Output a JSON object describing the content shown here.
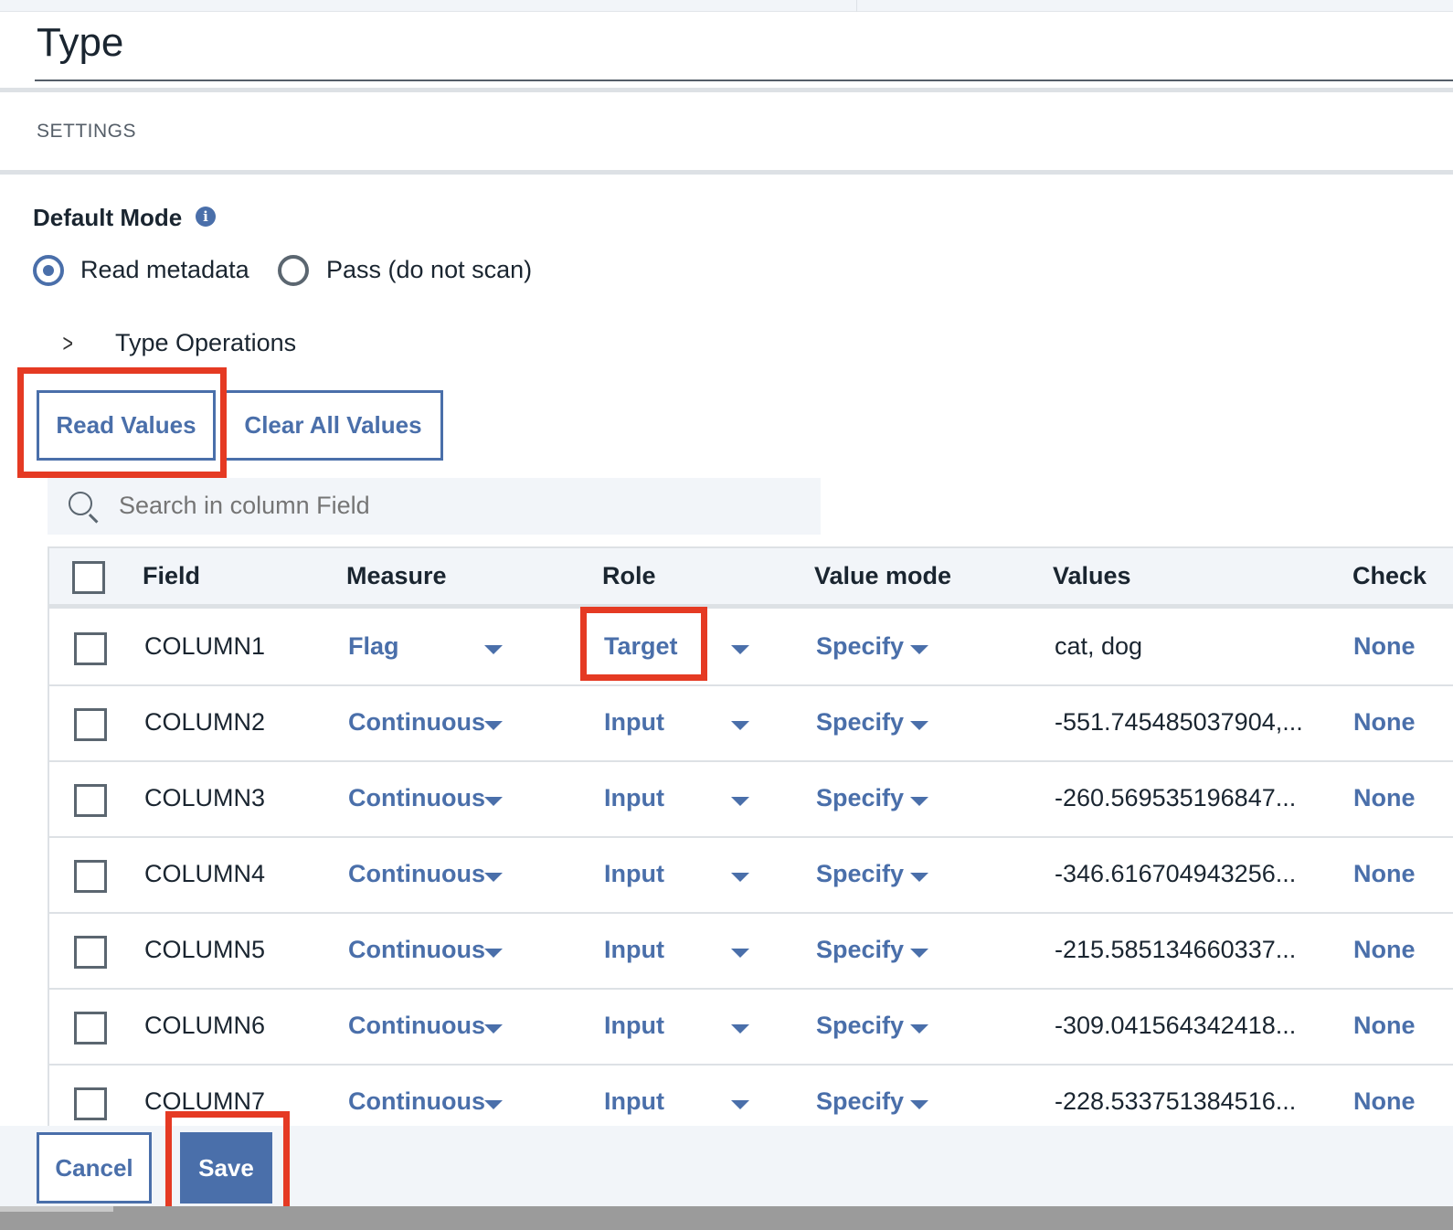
{
  "header": {
    "title": "Type",
    "section": "SETTINGS"
  },
  "default_mode": {
    "label": "Default Mode",
    "info_icon": "i",
    "options": [
      {
        "label": "Read metadata",
        "selected": true
      },
      {
        "label": "Pass (do not scan)",
        "selected": false
      }
    ]
  },
  "type_operations": {
    "label": "Type Operations"
  },
  "buttons": {
    "read_values": "Read Values",
    "clear_all_values": "Clear All Values",
    "cancel": "Cancel",
    "save": "Save"
  },
  "search": {
    "placeholder": "Search in column Field"
  },
  "table": {
    "columns": [
      "Field",
      "Measure",
      "Role",
      "Value mode",
      "Values",
      "Check"
    ],
    "rows": [
      {
        "field": "COLUMN1",
        "measure": "Flag",
        "role": "Target",
        "value_mode": "Specify",
        "values": "cat, dog",
        "check": "None"
      },
      {
        "field": "COLUMN2",
        "measure": "Continuous",
        "role": "Input",
        "value_mode": "Specify",
        "values": "-551.745485037904,...",
        "check": "None"
      },
      {
        "field": "COLUMN3",
        "measure": "Continuous",
        "role": "Input",
        "value_mode": "Specify",
        "values": "-260.569535196847...",
        "check": "None"
      },
      {
        "field": "COLUMN4",
        "measure": "Continuous",
        "role": "Input",
        "value_mode": "Specify",
        "values": "-346.616704943256...",
        "check": "None"
      },
      {
        "field": "COLUMN5",
        "measure": "Continuous",
        "role": "Input",
        "value_mode": "Specify",
        "values": "-215.585134660337...",
        "check": "None"
      },
      {
        "field": "COLUMN6",
        "measure": "Continuous",
        "role": "Input",
        "value_mode": "Specify",
        "values": "-309.041564342418...",
        "check": "None"
      },
      {
        "field": "COLUMN7",
        "measure": "Continuous",
        "role": "Input",
        "value_mode": "Specify",
        "values": "-228.533751384516...",
        "check": "None"
      }
    ]
  },
  "colors": {
    "accent": "#4a6faa",
    "highlight": "#e53a23"
  }
}
